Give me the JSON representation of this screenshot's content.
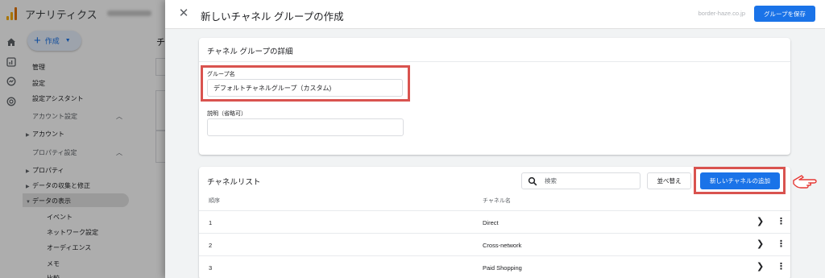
{
  "app": {
    "title": "アナリティクス",
    "create_label": "作成",
    "nav": {
      "top_items": [
        "管理",
        "設定",
        "設定アシスタント"
      ],
      "account_section": "アカウント設定",
      "account_items": [
        "アカウント"
      ],
      "property_section": "プロパティ設定",
      "property_items": [
        "プロパティ",
        "データの収集と修正",
        "データの表示"
      ],
      "data_display_items": [
        "イベント",
        "ネットワーク設定",
        "オーディエンス",
        "メモ",
        "比較"
      ]
    },
    "main_heading_fragment": "チ"
  },
  "drawer": {
    "title": "新しいチャネル グループの作成",
    "account": "border-haze.co.jp",
    "save_label": "グループを保存",
    "details": {
      "title": "チャネル グループの詳細",
      "group_name_label": "グループ名",
      "group_name_value": "デフォルトチャネルグループ（カスタム)",
      "description_label": "説明（省略可）",
      "description_value": ""
    },
    "channel_list": {
      "title": "チャネルリスト",
      "search_placeholder": "検索",
      "sort_label": "並べ替え",
      "add_label": "新しいチャネルの追加",
      "columns": [
        "順序",
        "チャネル名"
      ],
      "rows": [
        {
          "order": "1",
          "name": "Direct"
        },
        {
          "order": "2",
          "name": "Cross-network"
        },
        {
          "order": "3",
          "name": "Paid Shopping"
        }
      ]
    }
  },
  "colors": {
    "accent": "#1a73e8",
    "highlight": "#d9534f",
    "ga_logo": "#f9ab00"
  },
  "icons": {
    "close": "close-icon",
    "search": "search-icon",
    "row_open": "chevron-right-icon",
    "row_menu": "more-vert-icon",
    "annotation": "pointing-hand-icon"
  }
}
